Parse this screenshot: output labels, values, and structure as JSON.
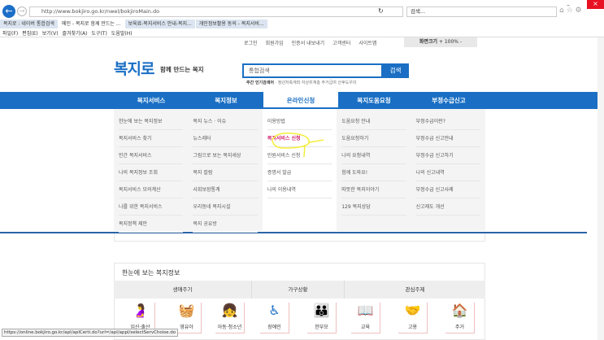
{
  "browser": {
    "url": "http://www.bokjiro.go.kr/nwel/bokjiroMain.do",
    "search_placeholder": "검색...",
    "tabs": [
      "복지로 : 네이버 통합검색",
      "메인 - 복지로 함께 만드는 ...",
      "보육료-복지서비스 안내-복지...",
      "개인정보활용 동의 - 복지서비..."
    ],
    "menu": [
      "파일(F)",
      "편집(E)",
      "보기(V)",
      "즐겨찾기(A)",
      "도구(T)",
      "도움말(H)"
    ],
    "status_url": "https://online.bokjiro.go.kr/apl/aplCerti.do?url=/apl/appl/selectServChoise.do"
  },
  "util_links": [
    "로그인",
    "회원가입",
    "인증서 내보내기",
    "고객센터",
    "사이트맵"
  ],
  "zoom": {
    "label": "화면크기",
    "value": "+ 100% -"
  },
  "logo": {
    "text": "복지로",
    "slogan": "함께 만드는 복지"
  },
  "search": {
    "value": "통합검색",
    "button": "검색",
    "popular_label": "주간 인기검색어",
    "popular": "· 청년저축계좌 자상위계층 주거급여 산후도우미"
  },
  "nav": [
    "복지서비스",
    "복지정보",
    "온라인신청",
    "복지도움요청",
    "부정수급신고"
  ],
  "dropdown": [
    [
      "한눈에 보는 복지정보",
      "복지서비스 찾기",
      "민간 복지서비스",
      "나의 복지정보 조회",
      "복지서비스 모의계산",
      "나를 위한 복지서비스",
      "복지정책 제안"
    ],
    [
      "복지 뉴스 · 이슈",
      "뉴스레터",
      "그림으로 보는 복지세상",
      "복지 칼럼",
      "사회보장통계",
      "우리동네 복지시설",
      "복지 공유방"
    ],
    [
      "이용방법",
      "복지서비스 신청",
      "민원서비스 신청",
      "증명서 발급",
      "나의 이용내역"
    ],
    [
      "도움요청 안내",
      "도움요청하기",
      "나의 요청내역",
      "함께 도와요!",
      "따뜻한 복지이야기",
      "129 복지상담"
    ],
    [
      "부정수급이란?",
      "부정수급 신고안내",
      "부정수급 신고하기",
      "나의 신고내역",
      "부정수급 신고사례",
      "신고제도 개선"
    ]
  ],
  "welfare": {
    "title": "한눈에 보는 복지정보",
    "categories": [
      "생애주기",
      "가구상황",
      "관심주제"
    ],
    "items": [
      "임신·출산",
      "영유아",
      "아동·청소년",
      "장애인",
      "한부모",
      "교육",
      "고용",
      "주거"
    ]
  }
}
